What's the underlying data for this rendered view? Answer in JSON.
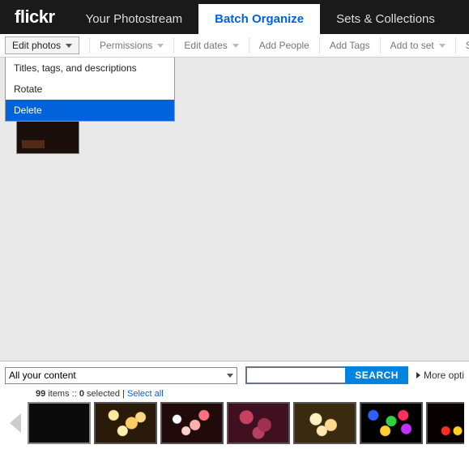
{
  "logo": "flickr",
  "tabs": {
    "photostream": "Your Photostream",
    "batch": "Batch Organize",
    "sets": "Sets & Collections"
  },
  "toolbar": {
    "edit_photos": "Edit photos",
    "permissions": "Permissions",
    "edit_dates": "Edit dates",
    "add_people": "Add People",
    "add_tags": "Add Tags",
    "add_to_set": "Add to set",
    "send_to_group": "Send to gro"
  },
  "dropdown": {
    "items": [
      "Titles, tags, and descriptions",
      "Rotate",
      "Delete"
    ],
    "highlighted_index": 2
  },
  "footer": {
    "content_select": "All your content",
    "search_button": "SEARCH",
    "more_options": "More opti",
    "status": {
      "count": "99",
      "items_label": "items",
      "sep": "::",
      "selected_count": "0",
      "selected_label": "selected",
      "divider": "|",
      "select_all": "Select all"
    }
  }
}
